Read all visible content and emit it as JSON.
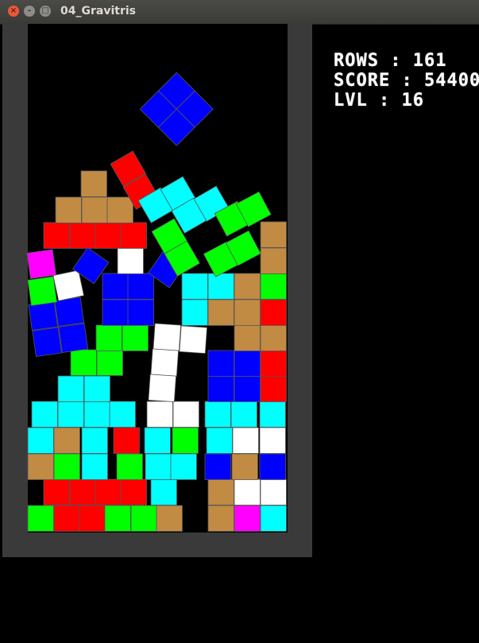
{
  "window": {
    "title": "04_Gravitris",
    "close_glyph": "×",
    "minimize_glyph": "–",
    "maximize_glyph": "□"
  },
  "hud": {
    "rows": "ROWS : 161",
    "score": "SCORE : 54400",
    "level": "LVL : 16"
  },
  "colors": {
    "cyan": "#00ffff",
    "green": "#00ff00",
    "red": "#ff0000",
    "blue": "#0000ff",
    "brown": "#c18b44",
    "white": "#ffffff",
    "magenta": "#ff00ff",
    "frame": "#3a3a3a",
    "block_edge": "#555555"
  }
}
